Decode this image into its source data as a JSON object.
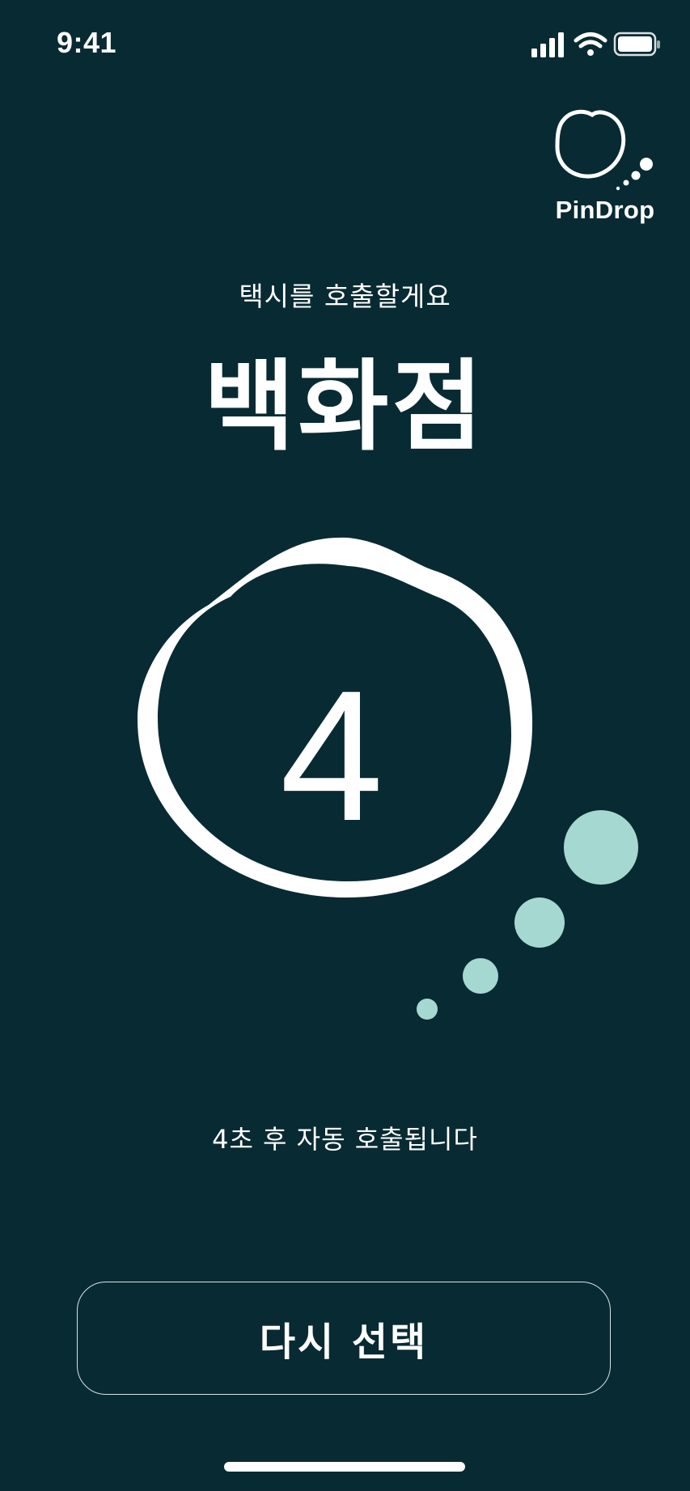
{
  "status_bar": {
    "time": "9:41",
    "icons": [
      "signal-icon",
      "wifi-icon",
      "battery-icon"
    ]
  },
  "brand": {
    "name": "PinDrop"
  },
  "header": {
    "subtitle": "택시를 호출할게요",
    "destination": "백화점"
  },
  "countdown": {
    "value": "4",
    "message": "4초 후 자동 호출됩니다"
  },
  "actions": {
    "reselect_label": "다시 선택"
  },
  "colors": {
    "background": "#082a33",
    "foreground": "#ffffff",
    "bubble_accent": "#a6d8d2"
  }
}
